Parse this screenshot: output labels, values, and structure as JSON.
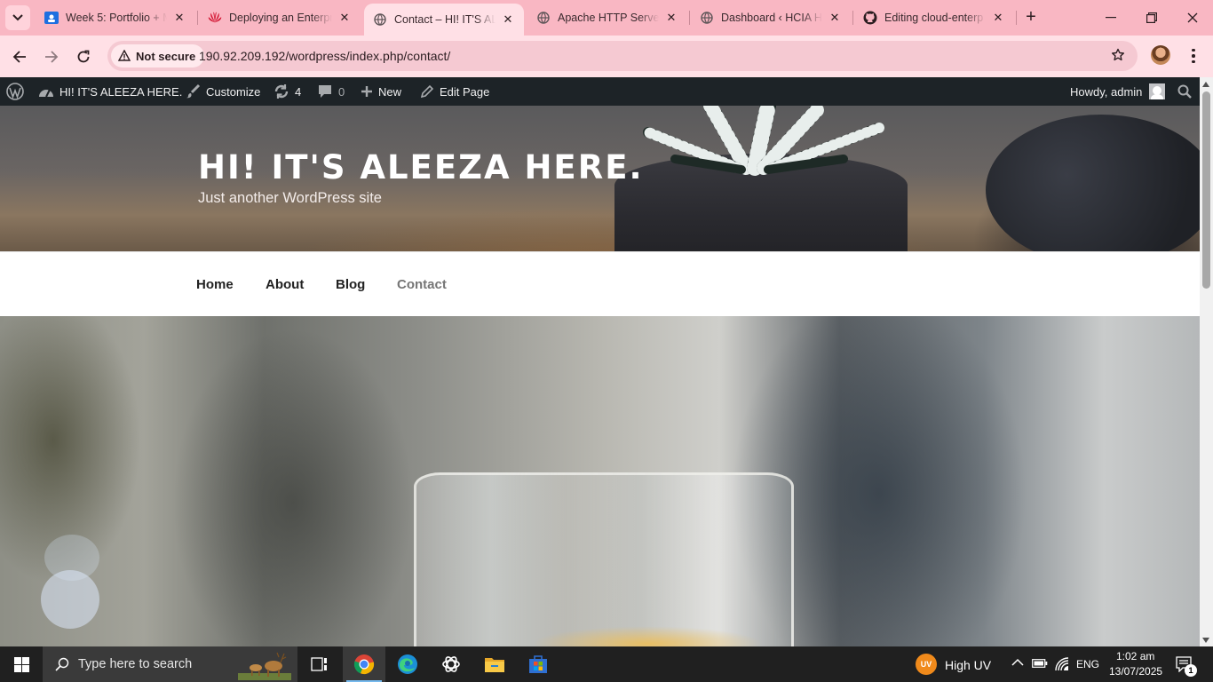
{
  "browser": {
    "tabs": [
      {
        "title": "Week 5: Portfolio + M",
        "favicon": "classroom-icon",
        "active": false
      },
      {
        "title": "Deploying an Enterpr",
        "favicon": "huawei-icon",
        "active": false
      },
      {
        "title": "Contact – HI! IT'S ALE",
        "favicon": "globe-icon",
        "active": true
      },
      {
        "title": "Apache HTTP Server",
        "favicon": "globe-icon",
        "active": false
      },
      {
        "title": "Dashboard ‹ HCIA HE",
        "favicon": "globe-icon",
        "active": false
      },
      {
        "title": "Editing cloud-enterp",
        "favicon": "github-icon",
        "active": false
      }
    ],
    "security_label": "Not secure",
    "url": "190.92.209.192/wordpress/index.php/contact/",
    "accent_color": "#f9b7c3"
  },
  "admin_bar": {
    "site_name": "HI! IT'S ALEEZA HERE.",
    "customize": "Customize",
    "updates_count": "4",
    "comments_count": "0",
    "new_label": "New",
    "edit_label": "Edit Page",
    "howdy": "Howdy, admin"
  },
  "site": {
    "title": "HI! IT'S ALEEZA HERE.",
    "description": "Just another WordPress site",
    "menu": [
      "Home",
      "About",
      "Blog",
      "Contact"
    ],
    "current_menu": "Contact"
  },
  "taskbar": {
    "search_placeholder": "Type here to search",
    "uv_badge": "UV",
    "uv_label": "High UV",
    "language": "ENG",
    "time": "1:02 am",
    "date": "13/07/2025",
    "notification_count": "1"
  }
}
